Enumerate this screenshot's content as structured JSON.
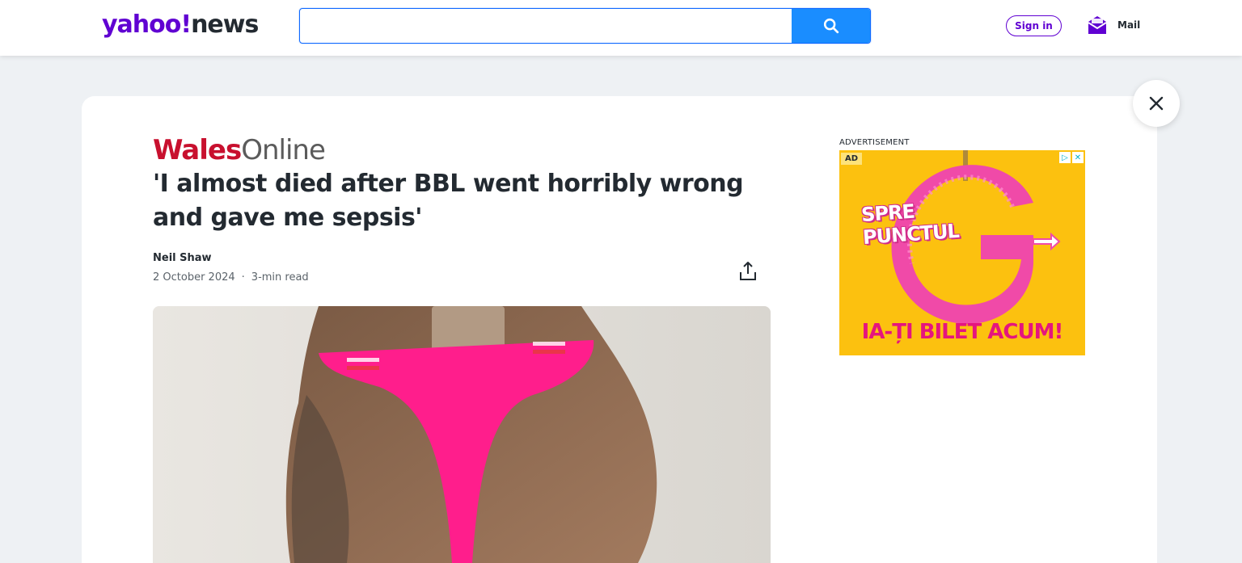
{
  "header": {
    "logo_part1": "yahoo!",
    "logo_part2": "news",
    "search_placeholder": "",
    "search_value": "",
    "signin_label": "Sign in",
    "mail_label": "Mail"
  },
  "article": {
    "source_part1": "Wales",
    "source_part2": "Online",
    "title": "'I almost died after BBL went horribly wrong and gave me sepsis'",
    "author": "Neil Shaw",
    "date": "2 October 2024",
    "separator": "·",
    "read_time": "3-min read"
  },
  "ad": {
    "label": "ADVERTISEMENT",
    "badge": "AD",
    "headline_line1": "SPRE",
    "headline_line2": "PUNCTUL",
    "cta": "IA-ȚI BILET ACUM!"
  },
  "colors": {
    "yahoo_purple": "#6001d2",
    "search_blue": "#1a8dff",
    "wales_red": "#c8102e",
    "ad_yellow": "#fcc10f",
    "ad_pink": "#e5157e"
  }
}
